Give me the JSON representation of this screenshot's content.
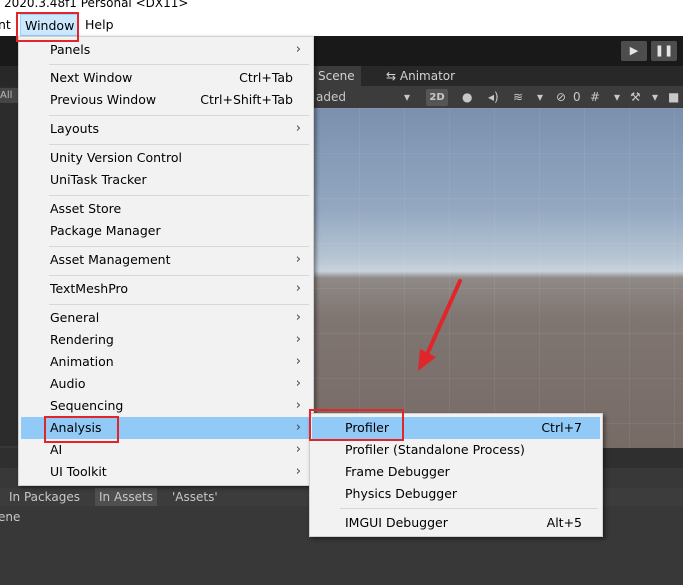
{
  "title": {
    "text": "2020.3.48f1 Personal <DX11>"
  },
  "menubar": {
    "left_fragment": "nt",
    "window": "Window",
    "help": "Help"
  },
  "toolbar": {
    "play_glyph": "▶",
    "pause_glyph": "❚❚"
  },
  "tabs": {
    "scene": "Scene",
    "animator": "Animator",
    "left_fragment": "All"
  },
  "scenebar": {
    "loaded_fragment": "aded",
    "two_d": "2D",
    "gizmo_count": "0"
  },
  "bottom": {
    "in_packages": "In Packages",
    "in_assets": "In Assets",
    "assets": "'Assets'",
    "scene_fragment": "ene"
  },
  "window_menu": {
    "items": [
      {
        "label": "Panels",
        "submenu": true
      },
      {
        "label": "Next Window",
        "shortcut": "Ctrl+Tab"
      },
      {
        "label": "Previous Window",
        "shortcut": "Ctrl+Shift+Tab"
      },
      {
        "label": "Layouts",
        "submenu": true
      },
      {
        "label": "Unity Version Control"
      },
      {
        "label": "UniTask Tracker"
      },
      {
        "label": "Asset Store"
      },
      {
        "label": "Package Manager"
      },
      {
        "label": "Asset Management",
        "submenu": true
      },
      {
        "label": "TextMeshPro",
        "submenu": true
      },
      {
        "label": "General",
        "submenu": true
      },
      {
        "label": "Rendering",
        "submenu": true
      },
      {
        "label": "Animation",
        "submenu": true
      },
      {
        "label": "Audio",
        "submenu": true
      },
      {
        "label": "Sequencing",
        "submenu": true
      },
      {
        "label": "Analysis",
        "submenu": true,
        "highlighted": true
      },
      {
        "label": "AI",
        "submenu": true
      },
      {
        "label": "UI Toolkit",
        "submenu": true
      }
    ]
  },
  "analysis_menu": {
    "items": [
      {
        "label": "Profiler",
        "shortcut": "Ctrl+7",
        "highlighted": true
      },
      {
        "label": "Profiler (Standalone Process)"
      },
      {
        "label": "Frame Debugger"
      },
      {
        "label": "Physics Debugger"
      },
      {
        "label": "IMGUI Debugger",
        "shortcut": "Alt+5"
      }
    ]
  },
  "colors": {
    "highlight": "#91c9f7",
    "annotation_red": "#e0262b",
    "menu_bg": "#f2f2f2"
  },
  "icons": {
    "submenu_arrow": "›"
  }
}
